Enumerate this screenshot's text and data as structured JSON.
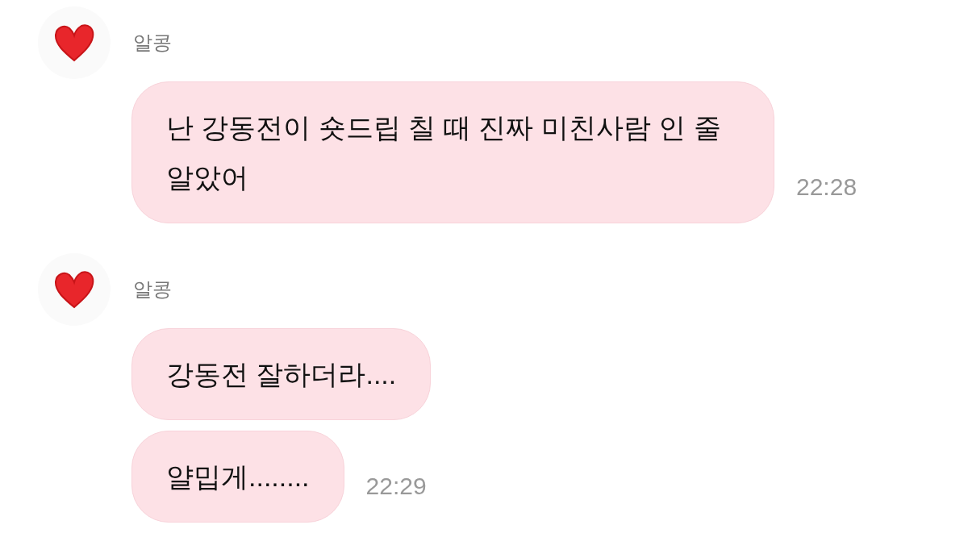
{
  "groups": [
    {
      "sender": "알콩",
      "messages": [
        {
          "text": "난 강동전이 숏드립 칠 때 진짜 미친사람 인 줄 알았어",
          "time": "22:28"
        }
      ]
    },
    {
      "sender": "알콩",
      "messages": [
        {
          "text": "강동전 잘하더라...."
        },
        {
          "text": "얄밉게........",
          "time": "22:29"
        }
      ]
    }
  ]
}
